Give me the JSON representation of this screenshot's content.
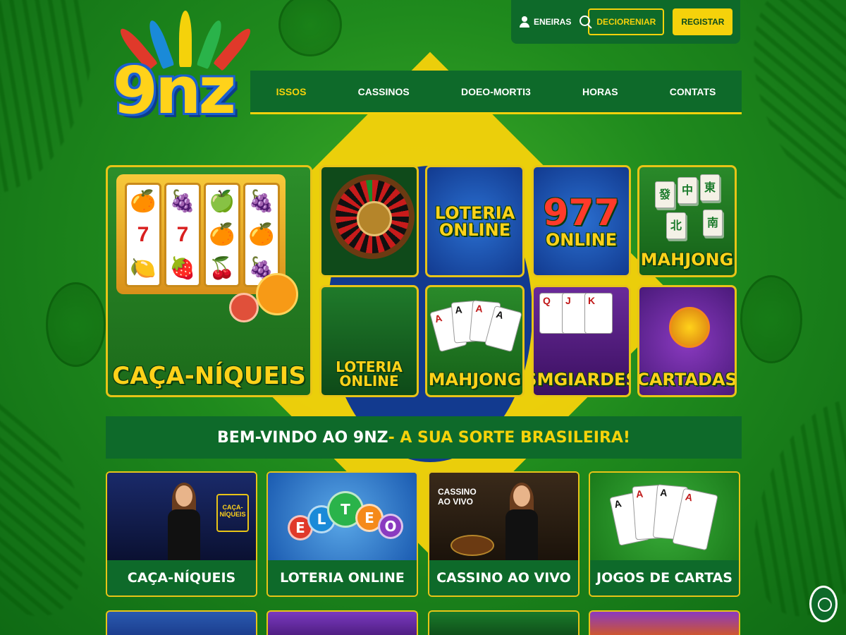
{
  "brand": {
    "logo_text": "9nz",
    "colors": {
      "green": "#0e6a2a",
      "yellow": "#f5d20b",
      "blue": "#123a8f"
    }
  },
  "topbar": {
    "user_label": "ENEIRAS",
    "user_icon": "user-icon",
    "search_icon": "search-icon",
    "outline_button": "DECIORENIAR",
    "register_button": "REGISTAR"
  },
  "nav": {
    "items": [
      "ISSOS",
      "CASSINOS",
      "DOEO-MORTI3",
      "HORAS",
      "CONTATS"
    ],
    "active": "ISSOS"
  },
  "games": {
    "featured": "CAÇA-NÍQUEIS",
    "tiles": [
      "LOTERIA ONLINE",
      "977 ONLINE",
      "MAHJONG",
      "LOTERIA ONLINE",
      "MAHJONG",
      "SMGIARDES",
      "CARTADAS"
    ],
    "tile_top_lines": {
      "loteria": "LOTERIA",
      "online": "ONLINE",
      "num977": "977"
    },
    "slot_symbols": [
      "7",
      "7"
    ]
  },
  "welcome": {
    "part1": "BEM-VINDO AO 9NZ",
    "part2": " - A SUA SORTE BRASILEIRA!"
  },
  "categories": [
    {
      "label": "CAÇA-NÍQUEIS",
      "sign": "CAÇA-\nNÍQUEIS"
    },
    {
      "label": "LOTERIA ONLINE",
      "balls": [
        "E",
        "L",
        "E",
        "T",
        "O"
      ]
    },
    {
      "label": "CASSINO AO VIVO",
      "sign": "CASSINO\nAO VIVO"
    },
    {
      "label": "JOGOS DE CARTAS"
    }
  ],
  "mahjong_glyphs": [
    "發",
    "中",
    "東",
    "北",
    "南"
  ],
  "card_ranks": [
    "A",
    "Q",
    "J",
    "K"
  ],
  "chat_icon": "chat-icon"
}
